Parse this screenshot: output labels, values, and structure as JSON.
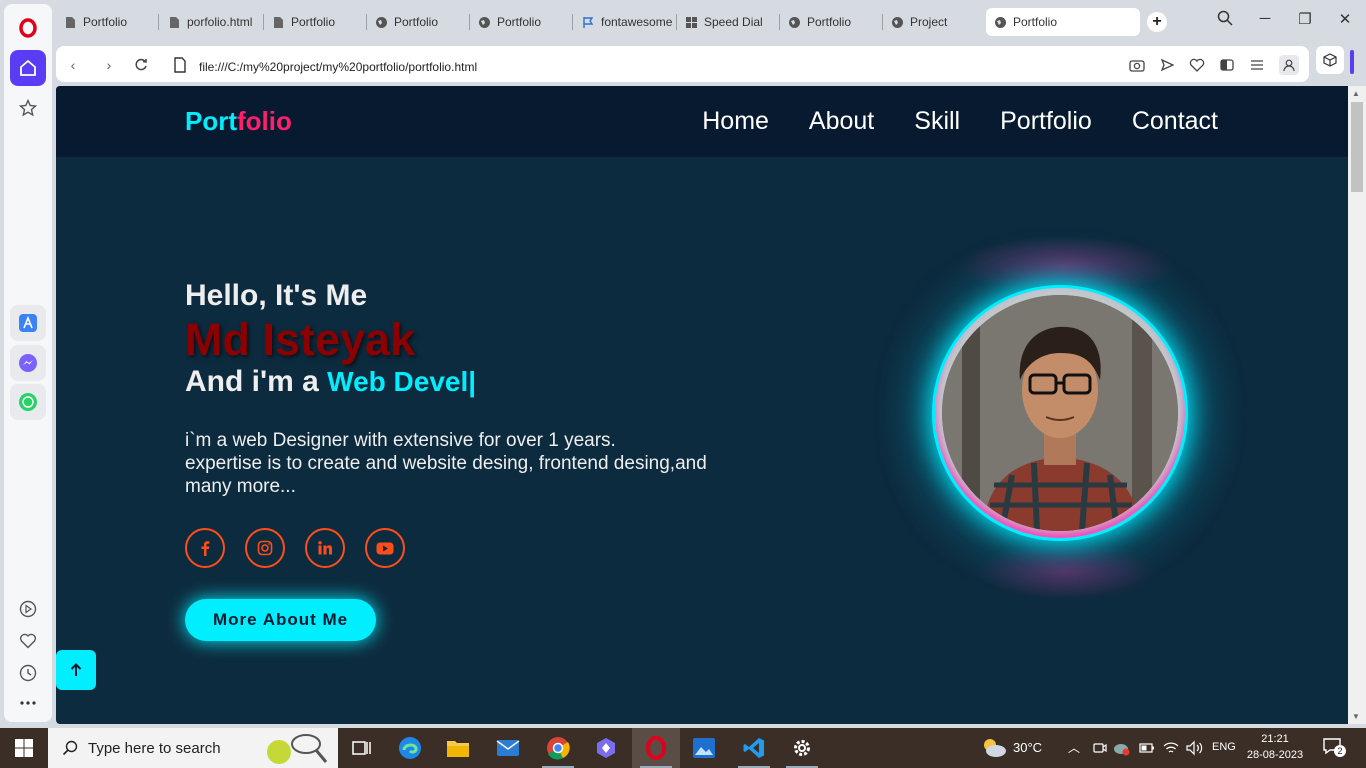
{
  "browser": {
    "tabs": [
      {
        "label": "Portfolio",
        "icon": "doc-icon"
      },
      {
        "label": "porfolio.html",
        "icon": "doc-icon"
      },
      {
        "label": "Portfolio",
        "icon": "doc-icon"
      },
      {
        "label": "Portfolio",
        "icon": "globe-icon"
      },
      {
        "label": "Portfolio",
        "icon": "globe-icon"
      },
      {
        "label": "fontawesome",
        "icon": "flag-icon"
      },
      {
        "label": "Speed Dial",
        "icon": "grid-icon"
      },
      {
        "label": "Portfolio",
        "icon": "globe-icon"
      },
      {
        "label": "Project",
        "icon": "globe-icon"
      },
      {
        "label": "Portfolio",
        "icon": "globe-icon",
        "active": true
      }
    ],
    "url": "file:///C:/my%20project/my%20portfolio/portfolio.html",
    "accent": "#5b3cf5"
  },
  "site": {
    "logo_part1": "Port",
    "logo_part2": "folio",
    "nav": [
      "Home",
      "About",
      "Skill",
      "Portfolio",
      "Contact"
    ],
    "greeting": "Hello, It's Me",
    "name": "Md Isteyak",
    "role_prefix": "And i'm a ",
    "role_typed": "Web Devel|",
    "desc_line1": "i`m a web Designer with extensive for over 1 years.",
    "desc_line2": "expertise is to create and website desing, frontend desing,and",
    "desc_line3": "many more...",
    "socials": [
      "facebook-icon",
      "instagram-icon",
      "linkedin-icon",
      "youtube-icon"
    ],
    "cta": "More About Me",
    "colors": {
      "accent": "#00eeff",
      "bg": "#0d2b3e",
      "header": "#081a2f",
      "name": "#8b0000",
      "logo2": "#ff1f6a",
      "social": "#ff4d1a"
    }
  },
  "taskbar": {
    "search_placeholder": "Type here to search",
    "weather": "30°C",
    "lang": "ENG",
    "time": "21:21",
    "date": "28-08-2023",
    "notifications": "2"
  }
}
